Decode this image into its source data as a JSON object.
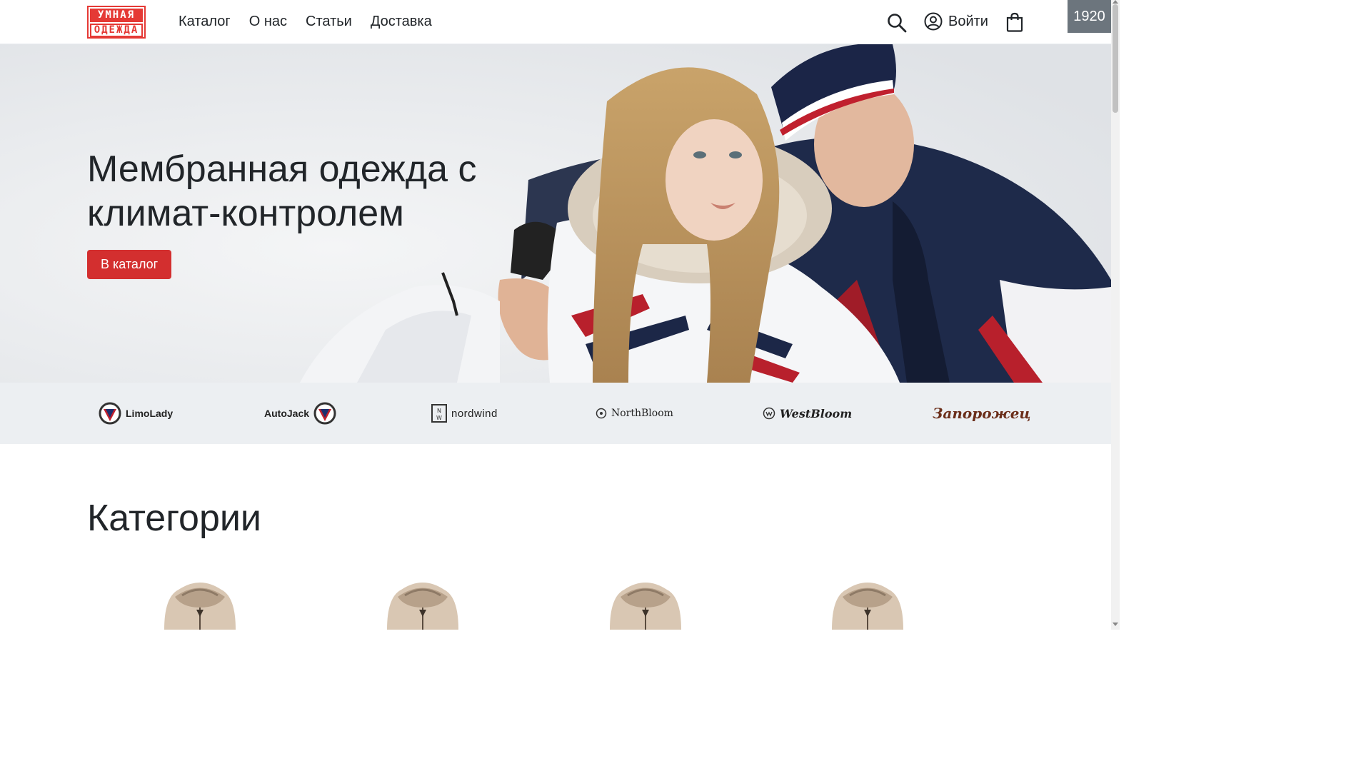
{
  "header": {
    "logo": {
      "line1": "УМНАЯ",
      "line2": "ОДЕЖДА"
    },
    "nav": [
      "Каталог",
      "О нас",
      "Статьи",
      "Доставка"
    ],
    "login_label": "Войти",
    "width_badge": "1920"
  },
  "hero": {
    "title": "Мембранная одежда с климат-контролем",
    "button_label": "В каталог"
  },
  "brands": [
    "LimoLady",
    "AutoJack",
    "nordwind",
    "NorthBloom",
    "WestBloom",
    "Запорожец"
  ],
  "categories": {
    "title": "Категории",
    "items": [
      "jacket",
      "jacket",
      "jacket",
      "jacket"
    ]
  },
  "colors": {
    "accent": "#d32f2f",
    "brand_strip_bg": "#eceff2",
    "badge_bg": "#6c757d"
  }
}
